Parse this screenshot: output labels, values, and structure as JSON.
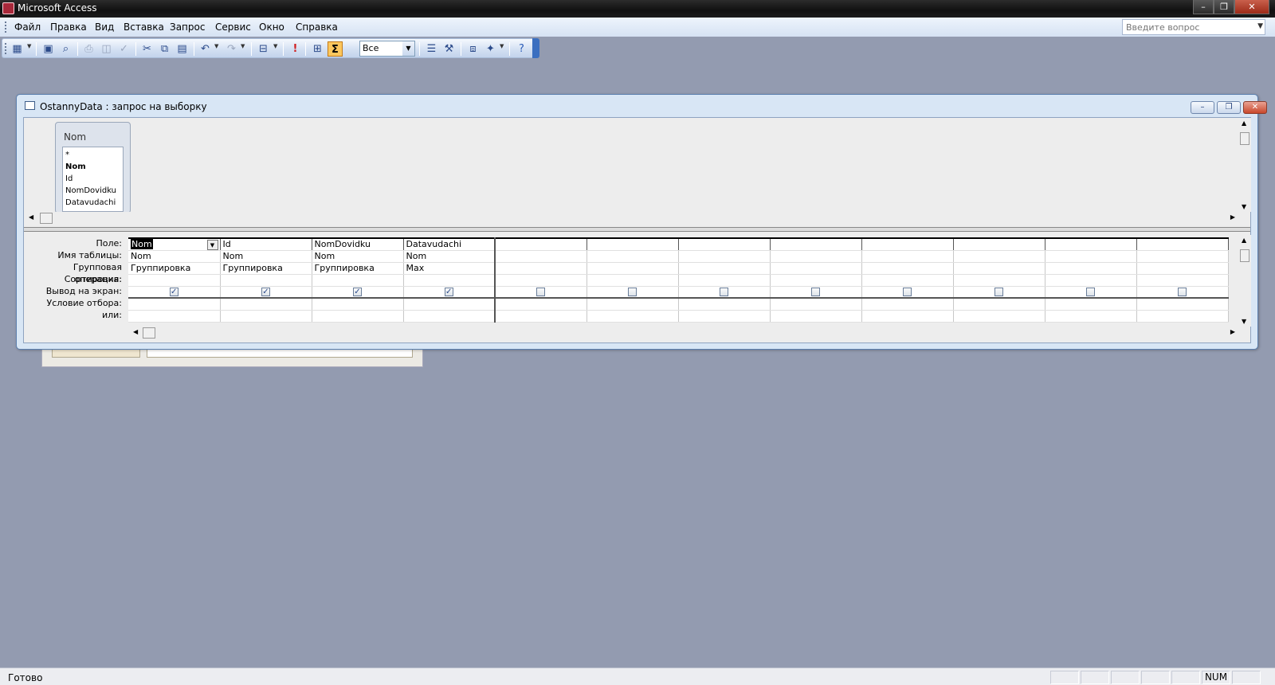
{
  "app": {
    "title": "Microsoft Access",
    "window_controls": [
      "–",
      "❐",
      "✕"
    ]
  },
  "menu": {
    "items": [
      "Файл",
      "Правка",
      "Вид",
      "Вставка",
      "Запрос",
      "Сервис",
      "Окно",
      "Справка"
    ],
    "ask_placeholder": "Введите вопрос"
  },
  "toolbar": {
    "top_values": "Все",
    "buttons": [
      "view-icon",
      "save-icon",
      "search-icon",
      "print-icon",
      "print-preview-icon",
      "spelling-icon",
      "cut-icon",
      "copy-icon",
      "paste-icon",
      "undo-icon",
      "redo-icon",
      "query-type-icon",
      "run-icon",
      "show-table-icon",
      "totals-icon",
      "properties-icon",
      "build-icon",
      "database-window-icon",
      "new-object-icon",
      "help-icon"
    ]
  },
  "query_window": {
    "title": "OstannyData : запрос на выборку",
    "field_list": {
      "table": "Nom",
      "fields": [
        "*",
        "Nom",
        "Id",
        "NomDovidku",
        "Datavudachi"
      ]
    },
    "row_labels": [
      "Поле:",
      "Имя таблицы:",
      "Групповая операция:",
      "Сортировка:",
      "Вывод на экран:",
      "Условие отбора:",
      "или:"
    ],
    "columns": [
      {
        "field": "Nom",
        "table": "Nom",
        "total": "Группировка",
        "sort": "",
        "show": true
      },
      {
        "field": "Id",
        "table": "Nom",
        "total": "Группировка",
        "sort": "",
        "show": true
      },
      {
        "field": "NomDovidku",
        "table": "Nom",
        "total": "Группировка",
        "sort": "",
        "show": true
      },
      {
        "field": "Datavudachi",
        "table": "Nom",
        "total": "Max",
        "sort": "",
        "show": true
      },
      {
        "field": "",
        "table": "",
        "total": "",
        "sort": "",
        "show": false
      },
      {
        "field": "",
        "table": "",
        "total": "",
        "sort": "",
        "show": false
      },
      {
        "field": "",
        "table": "",
        "total": "",
        "sort": "",
        "show": false
      },
      {
        "field": "",
        "table": "",
        "total": "",
        "sort": "",
        "show": false
      },
      {
        "field": "",
        "table": "",
        "total": "",
        "sort": "",
        "show": false
      },
      {
        "field": "",
        "table": "",
        "total": "",
        "sort": "",
        "show": false
      },
      {
        "field": "",
        "table": "",
        "total": "",
        "sort": "",
        "show": false
      },
      {
        "field": "",
        "table": "",
        "total": "",
        "sort": "",
        "show": false
      }
    ]
  },
  "status": {
    "text": "Готово",
    "num": "NUM"
  }
}
